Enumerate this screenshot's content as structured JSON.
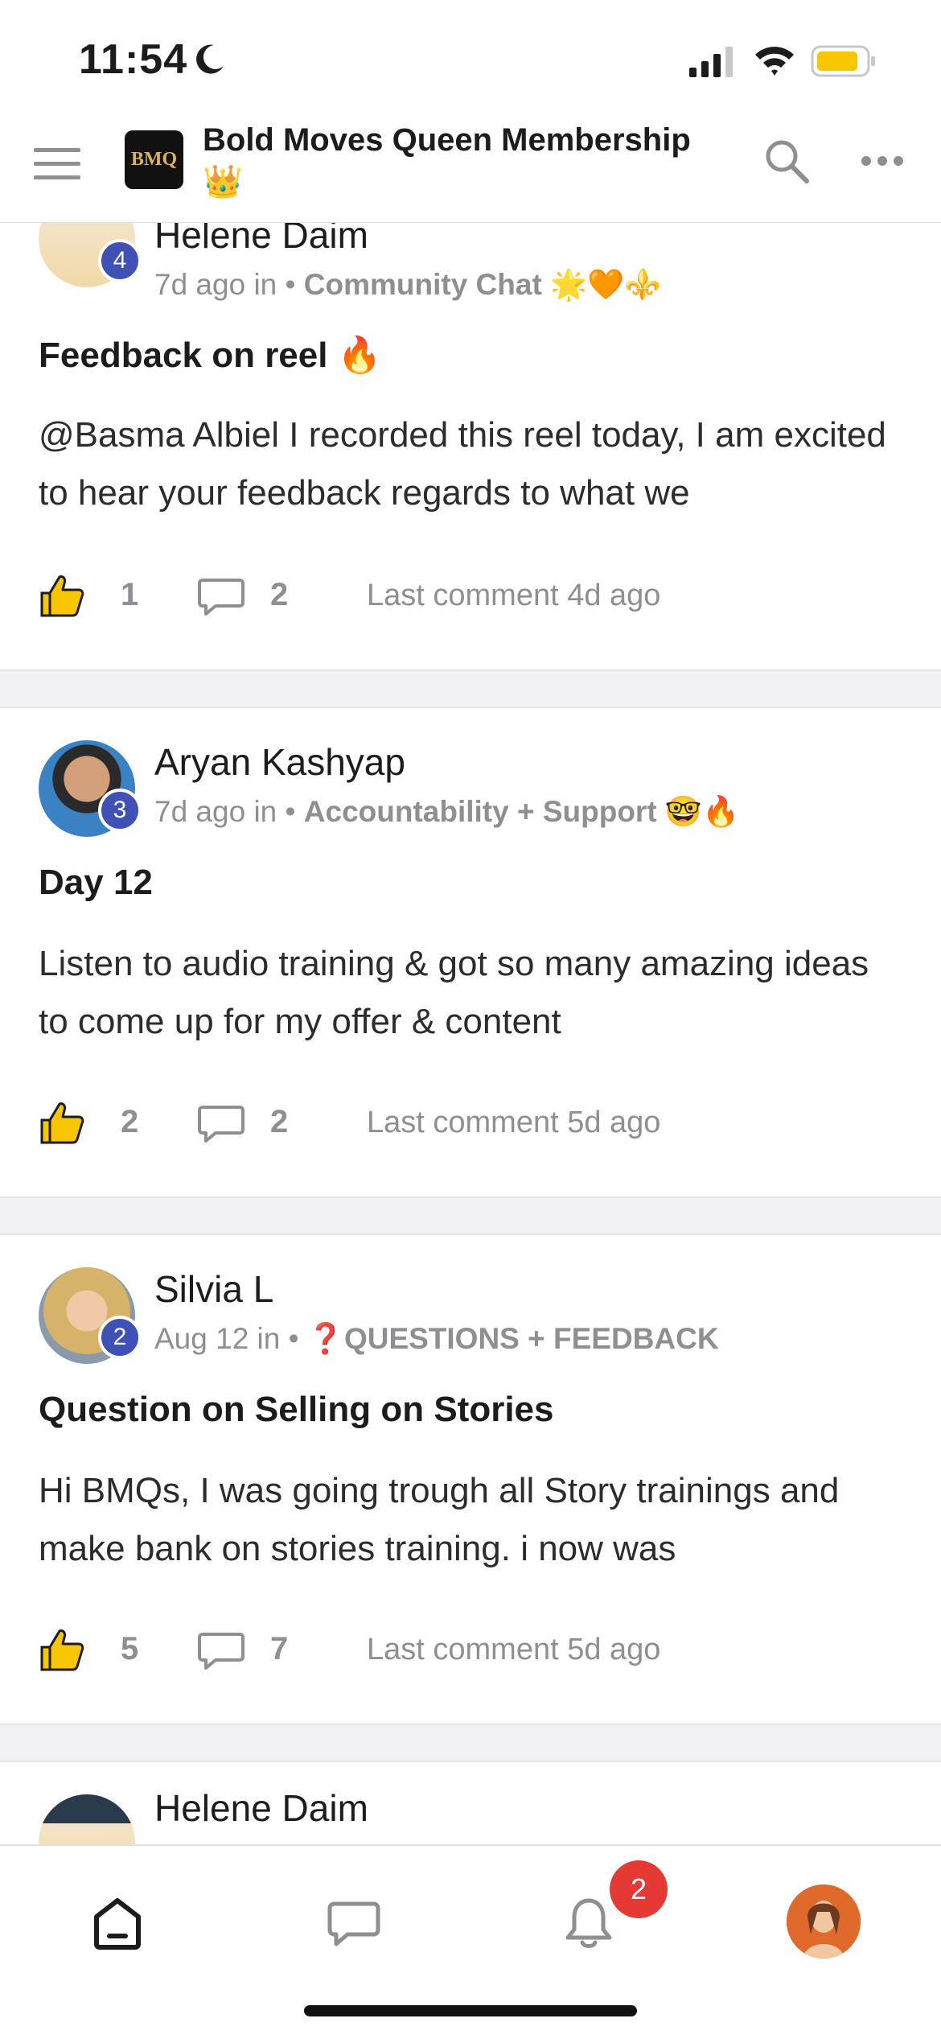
{
  "status_bar": {
    "time": "11:54"
  },
  "header": {
    "logo_text": "BMQ",
    "community_title": "Bold Moves Queen Membership 👑"
  },
  "posts": [
    {
      "author": "Helene Daim",
      "level": "4",
      "time": "7d ago in •",
      "space": "Community Chat 🌟🧡⚜️",
      "title": "Feedback on reel 🔥",
      "body": "@Basma Albiel I recorded this reel today, I am excited to hear your feedback regards to what we",
      "likes": "1",
      "comments": "2",
      "last_comment": "Last comment 4d ago"
    },
    {
      "author": "Aryan Kashyap",
      "level": "3",
      "time": "7d ago in •",
      "space": "Accountability + Support 🤓🔥",
      "title": "Day 12",
      "body": "Listen to audio training & got so many amazing ideas to come up for my offer & content",
      "likes": "2",
      "comments": "2",
      "last_comment": "Last comment 5d ago"
    },
    {
      "author": "Silvia L",
      "level": "2",
      "time": "Aug 12 in •",
      "space": "❓QUESTIONS + FEEDBACK",
      "title": "Question on Selling on Stories",
      "body": "Hi BMQs, I was going trough all Story trainings and make bank on stories training. i now was",
      "likes": "5",
      "comments": "7",
      "last_comment": "Last comment 5d ago"
    },
    {
      "author": "Helene Daim"
    }
  ],
  "tabbar": {
    "notifications_badge": "2",
    "icons": [
      "home-icon",
      "chat-icon",
      "bell-icon",
      "profile-avatar"
    ]
  },
  "colors": {
    "level_badge": "#3f51b5",
    "notification_badge": "#e53935",
    "battery": "#f7c600",
    "muted_text": "#8e8e93"
  }
}
